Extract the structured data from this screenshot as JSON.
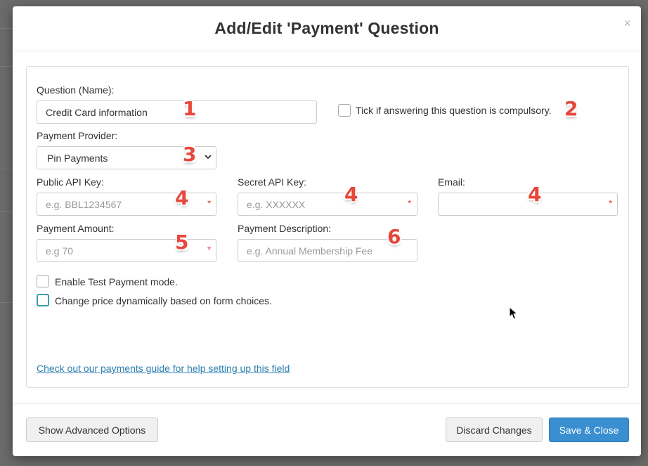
{
  "modal": {
    "title": "Add/Edit 'Payment' Question",
    "close_glyph": "×"
  },
  "form": {
    "question_label": "Question (Name):",
    "question_value": "Credit Card information",
    "compulsory_label": "Tick if answering this question is compulsory.",
    "provider_label": "Payment Provider:",
    "provider_value": "Pin Payments",
    "public_key_label": "Public API Key:",
    "public_key_placeholder": "e.g. BBL1234567",
    "secret_key_label": "Secret API Key:",
    "secret_key_placeholder": "e.g. XXXXXX",
    "email_label": "Email:",
    "email_placeholder": "",
    "amount_label": "Payment Amount:",
    "amount_placeholder": "e.g 70",
    "description_label": "Payment Description:",
    "description_placeholder": "e.g. Annual Membership Fee",
    "required_mark": "*",
    "test_mode_label": "Enable Test Payment mode.",
    "dynamic_price_label": "Change price dynamically based on form choices.",
    "guide_link": "Check out our payments guide for help setting up this field"
  },
  "annotations": [
    "1",
    "2",
    "3",
    "4",
    "4",
    "4",
    "5",
    "6"
  ],
  "footer": {
    "advanced_label": "Show Advanced Options",
    "discard_label": "Discard Changes",
    "save_label": "Save & Close"
  },
  "colors": {
    "primary": "#3a8fd0",
    "annotation": "#e8473c",
    "link": "#2b7fb0",
    "required": "#d9534f"
  }
}
